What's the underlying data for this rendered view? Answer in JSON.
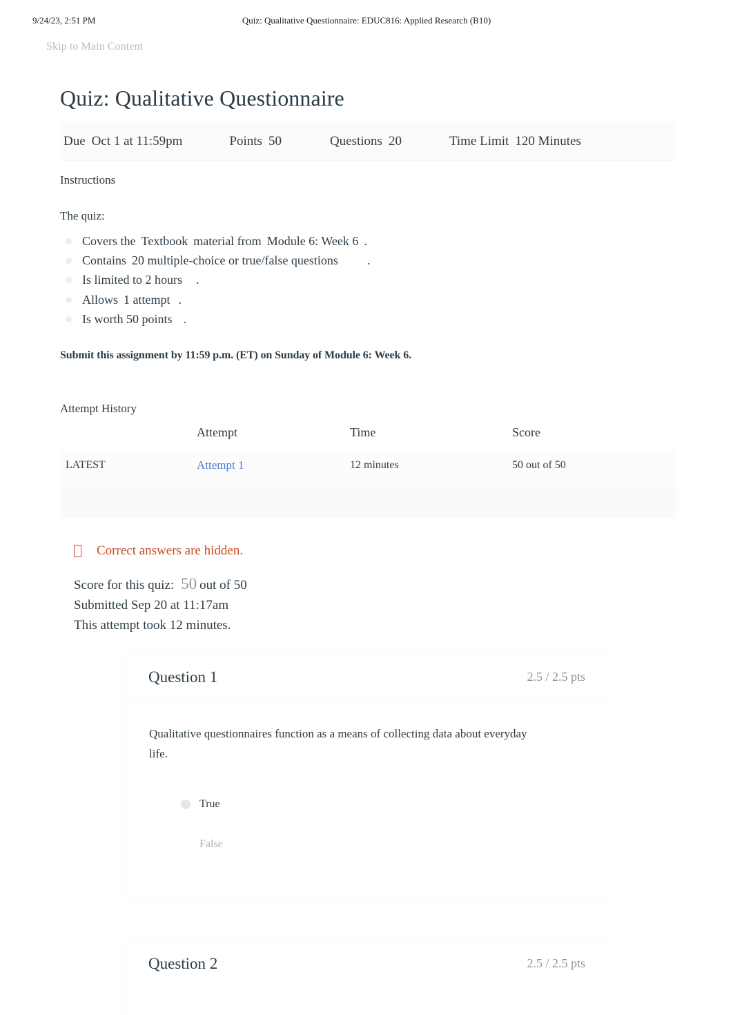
{
  "print_header": {
    "date": "9/24/23, 2:51 PM",
    "title": "Quiz: Qualitative Questionnaire: EDUC816: Applied Research (B10)"
  },
  "skip_link": "Skip to Main Content",
  "page_title": "Quiz: Qualitative Questionnaire",
  "meta": {
    "due_label": "Due",
    "due_value": "Oct 1 at 11:59pm",
    "points_label": "Points",
    "points_value": "50",
    "questions_label": "Questions",
    "questions_value": "20",
    "time_limit_label": "Time Limit",
    "time_limit_value": "120 Minutes"
  },
  "instructions": {
    "heading": "Instructions",
    "lead": "The quiz:",
    "items": [
      {
        "a": "Covers the",
        "b": "Textbook",
        "c": "material from",
        "d": "Module 6: Week 6",
        "e": "."
      },
      {
        "a": "Contains",
        "b": "20 multiple-choice or true/false questions",
        "c": "",
        "d": "",
        "e": "."
      },
      {
        "a": "Is limited to 2 hours",
        "b": "",
        "c": "",
        "d": "",
        "e": "."
      },
      {
        "a": "Allows",
        "b": "1 attempt",
        "c": "",
        "d": "",
        "e": "."
      },
      {
        "a": "Is worth 50 points",
        "b": "",
        "c": "",
        "d": "",
        "e": "."
      }
    ],
    "submit_note": "Submit this assignment by 11:59 p.m. (ET) on Sunday of Module 6: Week 6."
  },
  "attempt_history": {
    "heading": "Attempt History",
    "columns": [
      "",
      "Attempt",
      "Time",
      "Score"
    ],
    "rows": [
      {
        "kept": "LATEST",
        "attempt": "Attempt 1",
        "time": "12 minutes",
        "score": "50 out of 50"
      }
    ]
  },
  "hidden_answers_warning": "Correct answers are hidden.",
  "score_summary": {
    "score_label": "Score for this quiz:",
    "score_value": "50",
    "score_out_of": "out of 50",
    "submitted": "Submitted Sep 20 at 11:17am",
    "duration": "This attempt took 12 minutes."
  },
  "questions": [
    {
      "name": "Question 1",
      "points": "2.5 / 2.5 pts",
      "text": "Qualitative questionnaires function as a means of collecting data about everyday life.",
      "answers": [
        {
          "label": "True",
          "selected": true
        },
        {
          "label": "False",
          "selected": false
        }
      ]
    },
    {
      "name": "Question 2",
      "points": "2.5 / 2.5 pts",
      "text": "",
      "answers": []
    }
  ],
  "colors": {
    "text": "#2d3b45",
    "link": "#4a7fd4",
    "warning": "#ca4b1f",
    "muted": "#8d949b",
    "skip": "#b8bec4"
  }
}
